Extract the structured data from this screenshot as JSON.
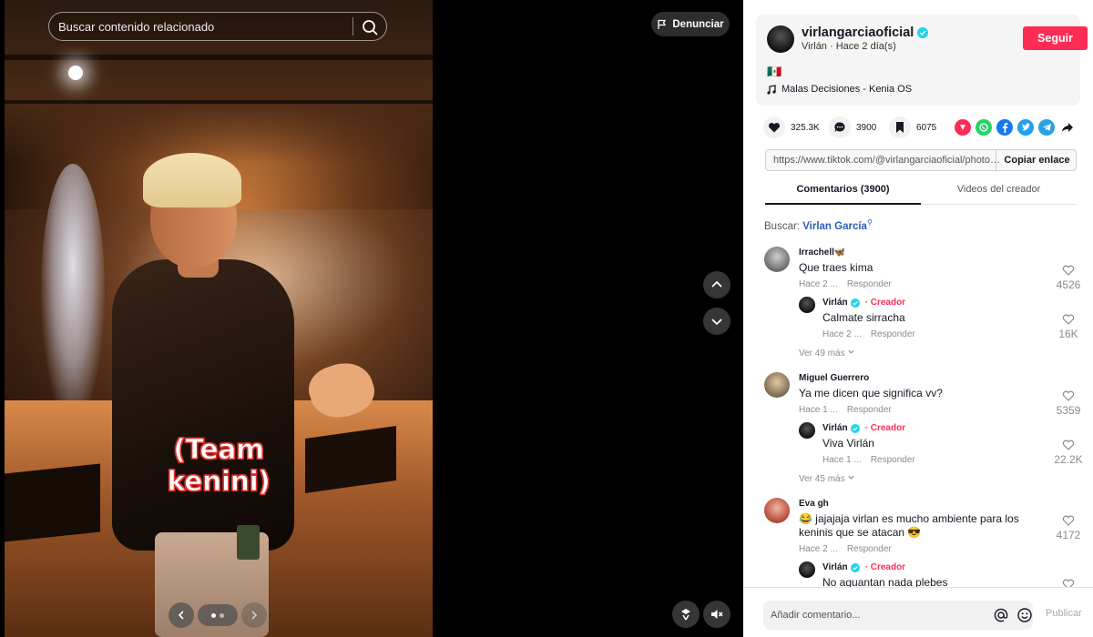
{
  "search": {
    "placeholder": "Buscar contenido relacionado"
  },
  "report_label": "Denunciar",
  "caption": "(Team kenini)",
  "post": {
    "username": "virlangarciaoficial",
    "subline": "Virlán · Hace 2 día(s)",
    "follow_label": "Seguir",
    "description": "🇲🇽",
    "music": "Malas Decisiones - Kenia OS"
  },
  "stats": {
    "likes": "325.3K",
    "comments": "3900",
    "saves": "6075"
  },
  "link": {
    "url": "https://www.tiktok.com/@virlangarciaoficial/photo/...",
    "copy_label": "Copiar enlace"
  },
  "tabs": [
    {
      "label": "Comentarios (3900)"
    },
    {
      "label": "Videos del creador"
    }
  ],
  "related": {
    "prefix": "Buscar:",
    "term": "Virlan García"
  },
  "comments": [
    {
      "name": "Irrachell🦋",
      "text": "Que traes kima",
      "time": "Hace 2 ...",
      "reply_label": "Responder",
      "likes": "4526",
      "reply": {
        "name": "Virlán",
        "badge": "Creador",
        "text": "Calmate sirracha",
        "time": "Hace 2 ...",
        "reply_label": "Responder",
        "likes": "16K"
      },
      "more": "Ver 49 más"
    },
    {
      "name": "Miguel Guerrero",
      "text": "Ya me dicen que significa vv?",
      "time": "Hace 1 ...",
      "reply_label": "Responder",
      "likes": "5359",
      "reply": {
        "name": "Virlán",
        "badge": "Creador",
        "text": "Viva Virlán",
        "time": "Hace 1 ...",
        "reply_label": "Responder",
        "likes": "22.2K"
      },
      "more": "Ver 45 más"
    },
    {
      "name": "Eva gh",
      "text_line1": "😂 jajajaja virlan es mucho ambiente para los",
      "text_line2": "keninis que se atacan 😎",
      "time": "Hace 2 ...",
      "reply_label": "Responder",
      "likes": "4172",
      "reply": {
        "name": "Virlán",
        "badge": "Creador",
        "text": "No aguantan nada plebes"
      }
    }
  ],
  "compose": {
    "placeholder": "Añadir comentario...",
    "publish_label": "Publicar"
  },
  "colors": {
    "accent": "#fe2c55",
    "link_blue": "#2b5db9",
    "verified": "#20d5ec"
  }
}
